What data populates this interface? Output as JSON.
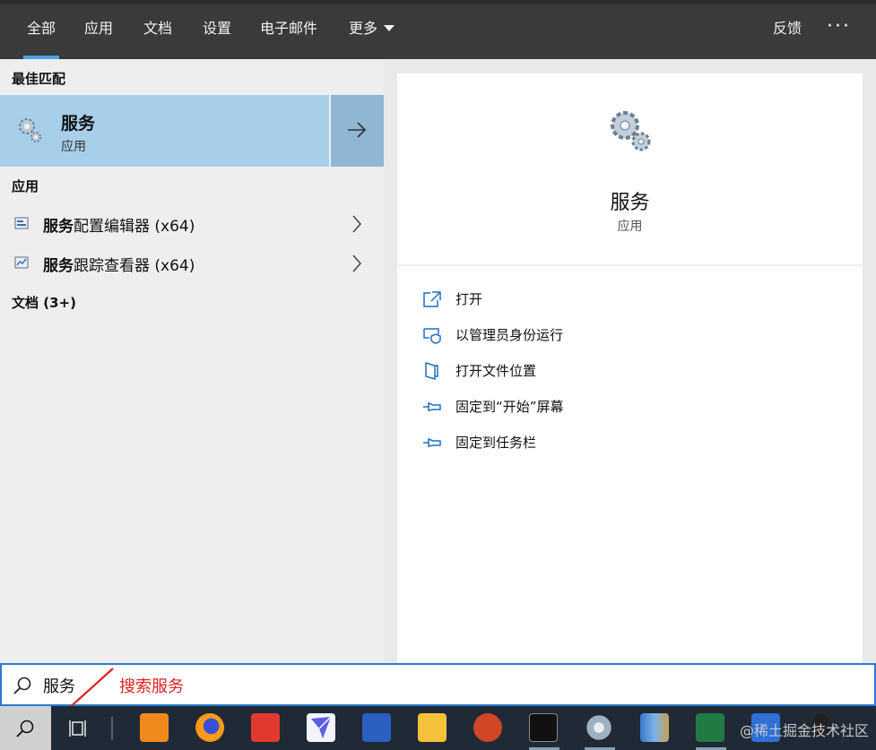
{
  "tabs": {
    "all": "全部",
    "apps": "应用",
    "docs": "文档",
    "settings": "设置",
    "email": "电子邮件",
    "more": "更多",
    "feedback": "反馈",
    "more_options": "···"
  },
  "left": {
    "best_match_header": "最佳匹配",
    "best_match": {
      "title": "服务",
      "subtitle": "应用"
    },
    "apps_header": "应用",
    "apps": [
      {
        "bold": "服务",
        "rest": "配置编辑器 (x64)"
      },
      {
        "bold": "服务",
        "rest": "跟踪查看器 (x64)"
      }
    ],
    "docs_header": "文档 (3+)"
  },
  "right": {
    "title": "服务",
    "subtitle": "应用",
    "actions": [
      {
        "label": "打开",
        "icon": "open-icon"
      },
      {
        "label": "以管理员身份运行",
        "icon": "shield-icon"
      },
      {
        "label": "打开文件位置",
        "icon": "file-location-icon"
      },
      {
        "label": "固定到“开始”屏幕",
        "icon": "pin-icon"
      },
      {
        "label": "固定到任务栏",
        "icon": "pin-icon"
      }
    ]
  },
  "search": {
    "query": "服务",
    "annotation": "搜索服务"
  },
  "taskbar": {
    "apps": [
      "search-icon",
      "task-view-icon",
      "uc-browser-icon",
      "firefox-icon",
      "youdao-icon",
      "feishu-icon",
      "word-icon",
      "file-explorer-icon",
      "powerpoint-icon",
      "terminal-icon",
      "services-icon",
      "winrar-icon",
      "excel-icon",
      "wps-icon",
      "qq-icon"
    ],
    "watermark": "@稀土掘金技术社区"
  },
  "colors": {
    "accent": "#2a7bd1",
    "selected": "#a8cfea",
    "annotation": "#e02020"
  }
}
